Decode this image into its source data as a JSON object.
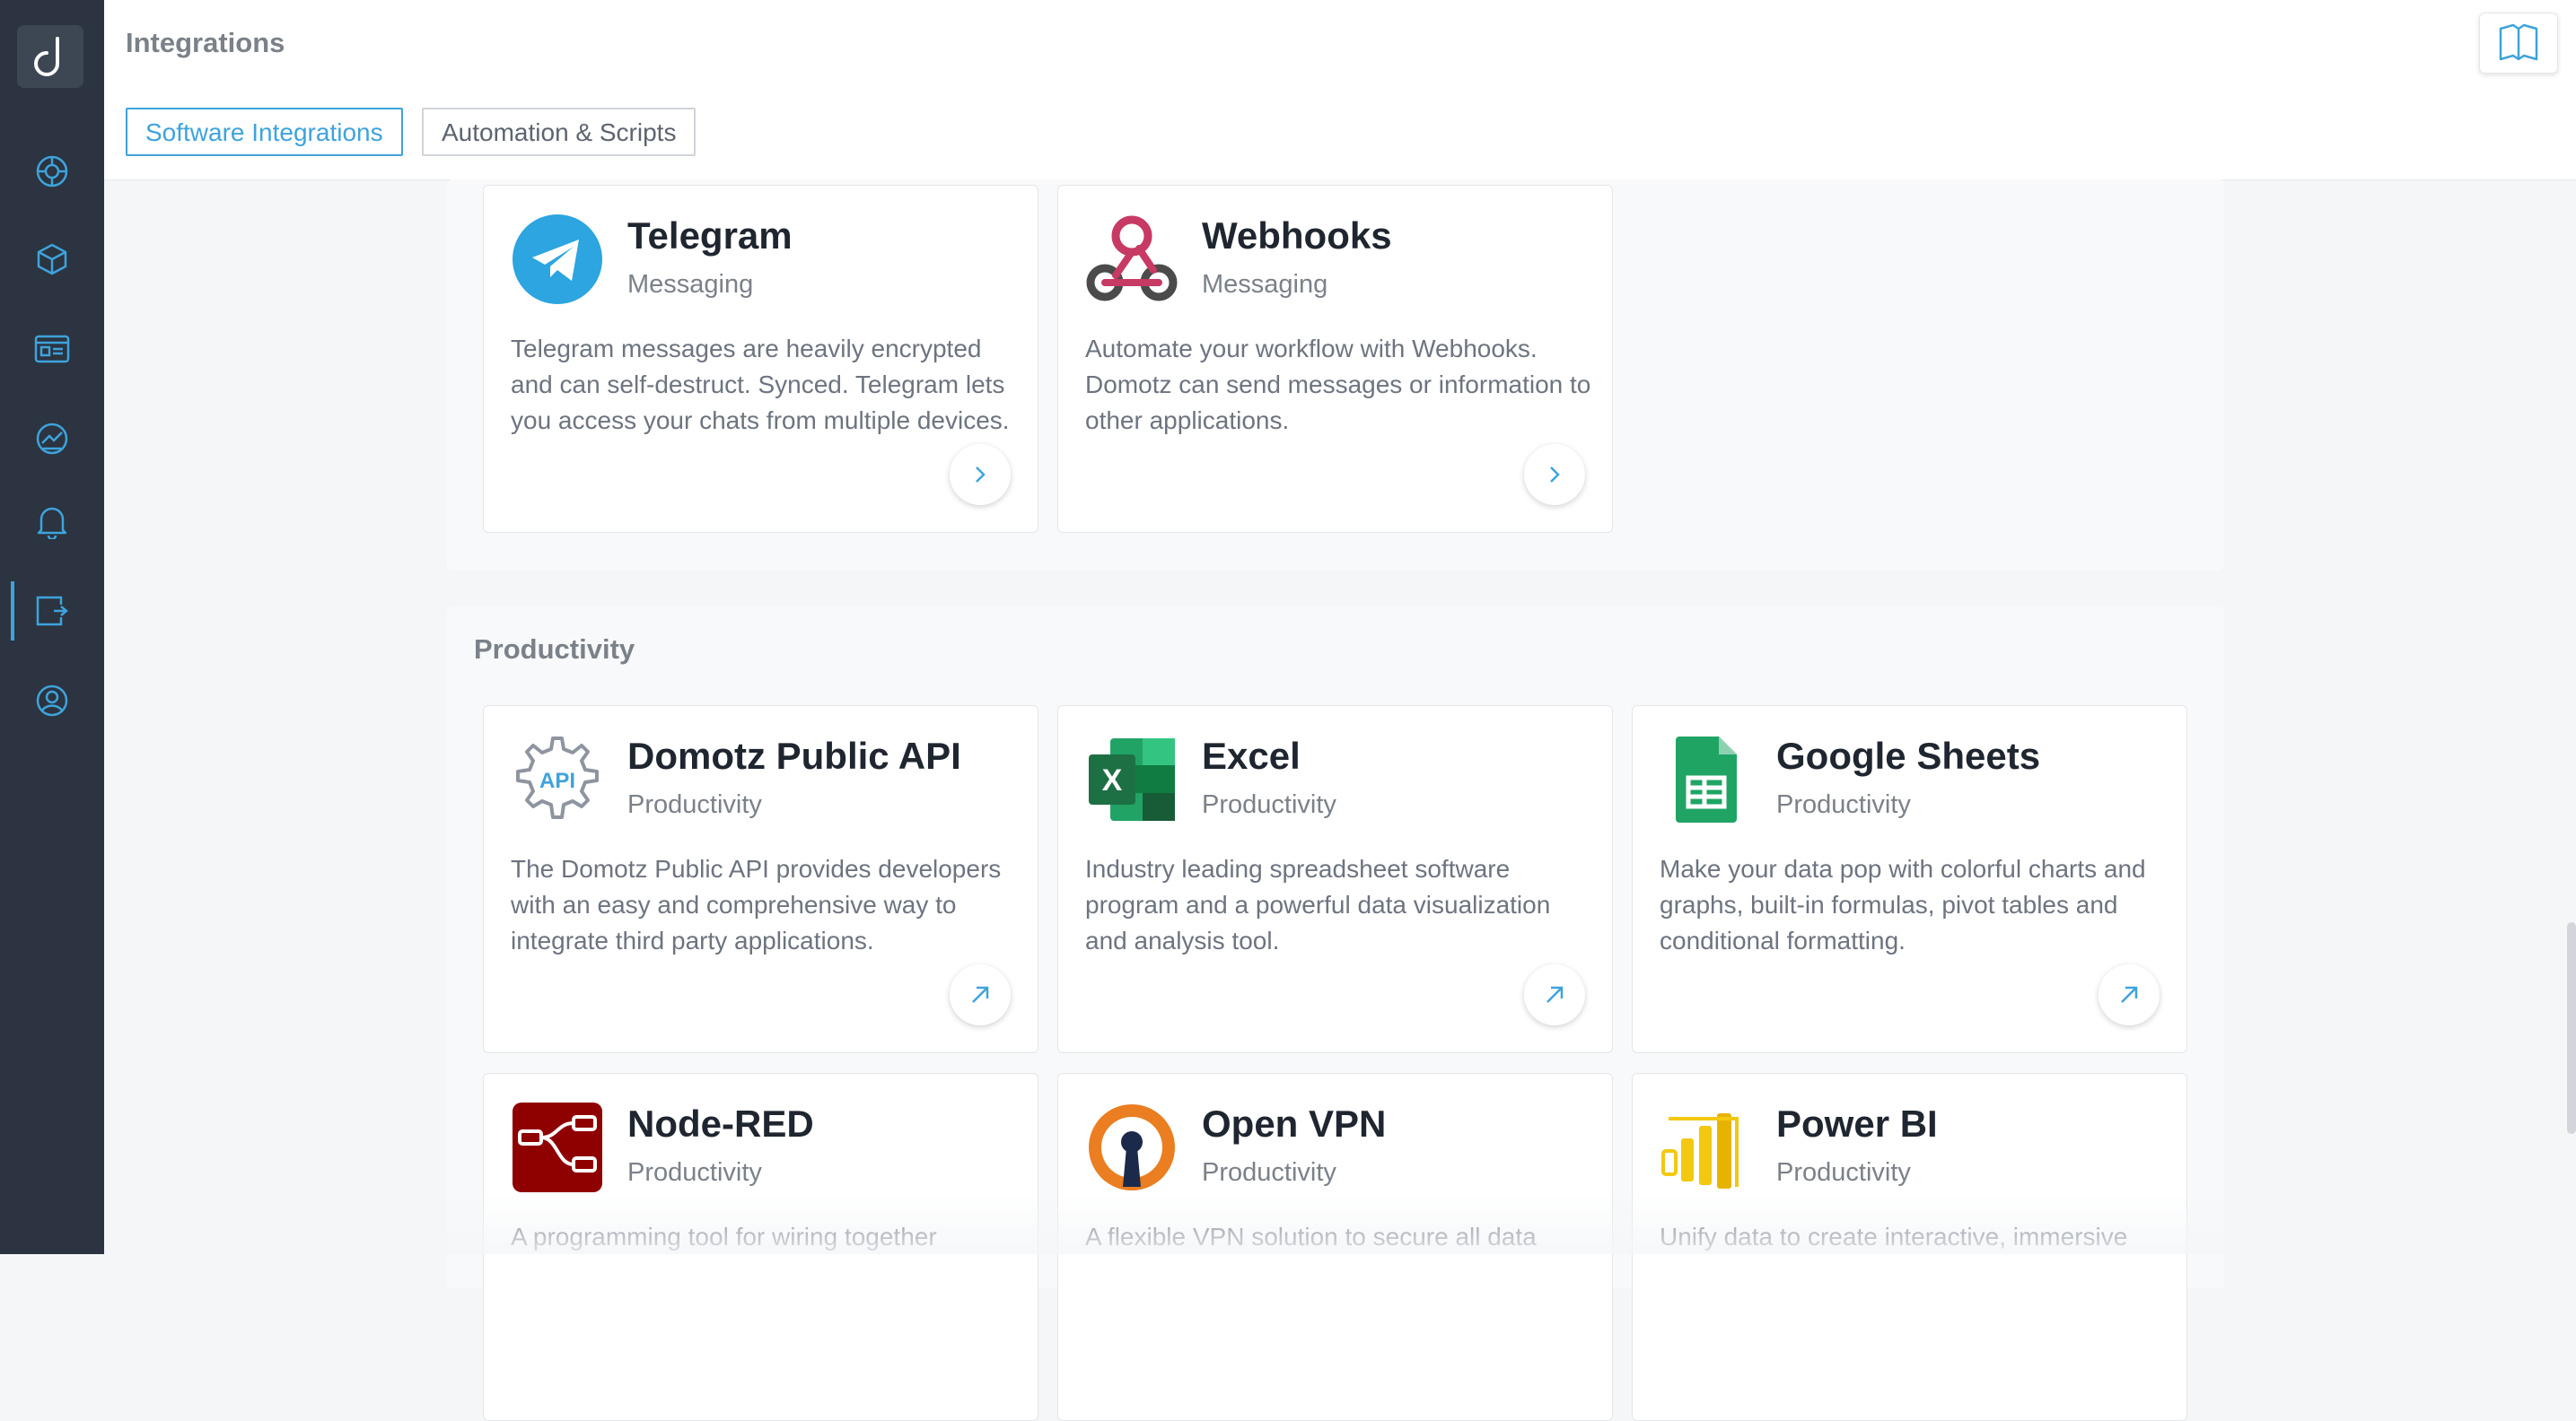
{
  "header": {
    "title": "Integrations",
    "tabs": [
      {
        "label": "Software Integrations",
        "active": true
      },
      {
        "label": "Automation & Scripts",
        "active": false
      }
    ]
  },
  "sidebar": {
    "items": [
      {
        "icon": "network-globe-icon"
      },
      {
        "icon": "cube-icon"
      },
      {
        "icon": "dashboard-card-icon"
      },
      {
        "icon": "monitor-gauge-icon"
      },
      {
        "icon": "bell-icon"
      },
      {
        "icon": "integrations-plug-icon",
        "active": true
      },
      {
        "icon": "user-account-icon"
      }
    ]
  },
  "sections": {
    "messaging": {
      "cards": [
        {
          "title": "Telegram",
          "category": "Messaging",
          "description": "Telegram messages are heavily encrypted and can self-destruct. Synced. Telegram lets you access your chats from multiple devices.",
          "action": "chevron-right-icon"
        },
        {
          "title": "Webhooks",
          "category": "Messaging",
          "description": "Automate your workflow with Webhooks. Domotz can send messages or information to other applications.",
          "action": "chevron-right-icon"
        }
      ]
    },
    "productivity": {
      "title": "Productivity",
      "cards": [
        {
          "title": "Domotz Public API",
          "category": "Productivity",
          "logo_text": "API",
          "description": "The Domotz Public API provides developers with an easy and comprehensive way to integrate third party applications.",
          "action": "external-link-icon"
        },
        {
          "title": "Excel",
          "category": "Productivity",
          "logo_text": "X",
          "description": "Industry leading spreadsheet software program and a powerful data visualization and analysis tool.",
          "action": "external-link-icon"
        },
        {
          "title": "Google Sheets",
          "category": "Productivity",
          "description": "Make your data pop with colorful charts and graphs, built-in formulas, pivot tables and conditional formatting.",
          "action": "external-link-icon"
        },
        {
          "title": "Node-RED",
          "category": "Productivity",
          "description": "A programming tool for wiring together"
        },
        {
          "title": "Open VPN",
          "category": "Productivity",
          "description": "A flexible VPN solution to secure all data"
        },
        {
          "title": "Power BI",
          "category": "Productivity",
          "description": "Unify data to create interactive, immersive"
        }
      ]
    }
  },
  "colors": {
    "accent": "#3ea3dc",
    "sidebar": "#2b3440",
    "telegram": "#2ca5e0",
    "webhooks": "#c73a63",
    "excel": "#1d7044",
    "sheets": "#20a464",
    "nodered": "#8f0000",
    "openvpn": "#ea7e20",
    "powerbi": "#f2c811"
  }
}
